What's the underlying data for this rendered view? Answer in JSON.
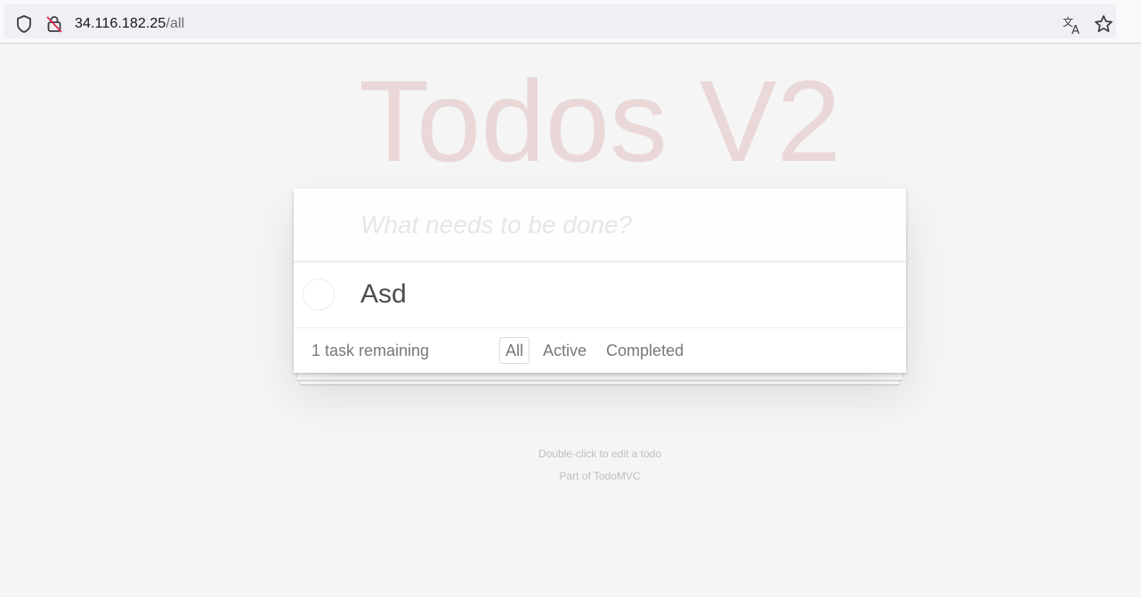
{
  "browser": {
    "url_host": "34.116.182.25",
    "url_path": "/all",
    "icons": [
      "shield-icon",
      "lock-icon",
      "translate-icon",
      "star-icon"
    ]
  },
  "app": {
    "title": "Todos V2",
    "new_todo_placeholder": "What needs to be done?",
    "new_todo_value": "",
    "todos": [
      {
        "label": "Asd",
        "completed": false
      }
    ],
    "footer": {
      "count_text": "1 task remaining",
      "filters": [
        {
          "label": "All",
          "selected": true
        },
        {
          "label": "Active",
          "selected": false
        },
        {
          "label": "Completed",
          "selected": false
        }
      ]
    },
    "info": {
      "hint": "Double-click to edit a todo",
      "credit": "Part of TodoMVC"
    }
  },
  "colors": {
    "page_background": "#f5f5f5",
    "title_color": "rgba(175,47,47,0.15)",
    "text_color": "#4d4d4d",
    "muted_text": "#777777"
  }
}
